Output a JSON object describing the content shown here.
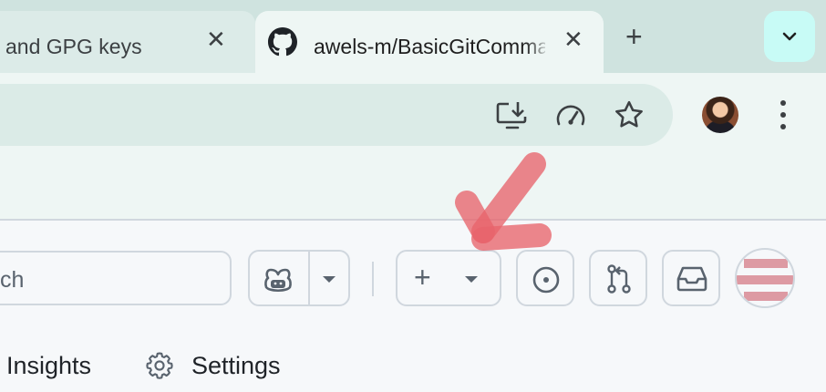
{
  "tabs": {
    "inactive_title": "and GPG keys",
    "active_title": "awels-m/BasicGitCommands",
    "close_glyph": "✕",
    "new_tab_glyph": "+",
    "favicon": "github-icon"
  },
  "toolbar": {
    "icons": [
      "install-app-icon",
      "performance-icon",
      "bookmark-star-icon",
      "profile-avatar",
      "more-menu-icon"
    ]
  },
  "github_header": {
    "search_placeholder": "ch",
    "copilot_icon": "copilot-icon",
    "create_new_glyph": "+",
    "icons": [
      "issues-icon",
      "pull-requests-icon",
      "inbox-icon",
      "user-avatar"
    ]
  },
  "repo_nav": {
    "insights_label": "Insights",
    "settings_label": "Settings"
  },
  "colors": {
    "tabstrip": "#cfe3df",
    "active_tab": "#eef6f4",
    "annotation_arrow": "#e8646c"
  }
}
